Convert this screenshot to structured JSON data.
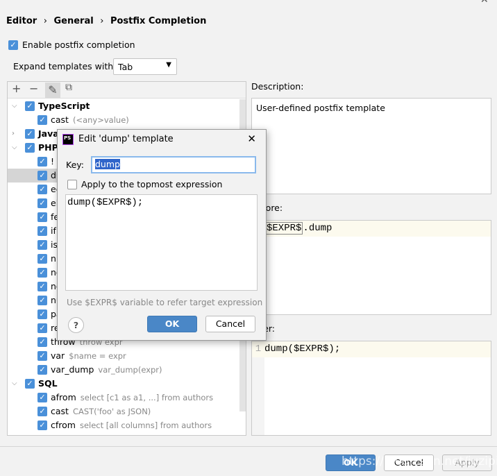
{
  "breadcrumb": [
    "Editor",
    "General",
    "Postfix Completion"
  ],
  "enable_label": "Enable postfix completion",
  "expand": {
    "label": "Expand templates with",
    "value": "Tab"
  },
  "toolbar": {
    "add": "+",
    "remove": "−",
    "edit": "✎",
    "copy": "⧉"
  },
  "tree": [
    {
      "type": "group",
      "label": "TypeScript",
      "expanded": true
    },
    {
      "type": "item",
      "label": "cast",
      "hint": "(<any>value)"
    },
    {
      "type": "group",
      "label": "Java",
      "expanded": false
    },
    {
      "type": "group",
      "label": "PHP",
      "expanded": true
    },
    {
      "type": "item",
      "label": "!",
      "hint": ""
    },
    {
      "type": "item",
      "label": "dump",
      "hint": "",
      "selected": true
    },
    {
      "type": "item",
      "label": "ec",
      "hint": ""
    },
    {
      "type": "item",
      "label": "el",
      "hint": ""
    },
    {
      "type": "item",
      "label": "fe",
      "hint": ""
    },
    {
      "type": "item",
      "label": "if",
      "hint": ""
    },
    {
      "type": "item",
      "label": "is",
      "hint": ""
    },
    {
      "type": "item",
      "label": "nn",
      "hint": ""
    },
    {
      "type": "item",
      "label": "no",
      "hint": ""
    },
    {
      "type": "item",
      "label": "no",
      "hint": ""
    },
    {
      "type": "item",
      "label": "nu",
      "hint": ""
    },
    {
      "type": "item",
      "label": "pa",
      "hint": ""
    },
    {
      "type": "item",
      "label": "re",
      "hint": ""
    },
    {
      "type": "item",
      "label": "throw",
      "hint": "throw expr"
    },
    {
      "type": "item",
      "label": "var",
      "hint": "$name = expr"
    },
    {
      "type": "item",
      "label": "var_dump",
      "hint": "var_dump(expr)"
    },
    {
      "type": "group",
      "label": "SQL",
      "expanded": true
    },
    {
      "type": "item",
      "label": "afrom",
      "hint": "select [c1 as a1, ...] from authors"
    },
    {
      "type": "item",
      "label": "cast",
      "hint": "CAST('foo' as JSON)"
    },
    {
      "type": "item",
      "label": "cfrom",
      "hint": "select [all columns] from authors"
    }
  ],
  "description": {
    "label": "Description:",
    "text": "User-defined postfix template"
  },
  "before": {
    "label": "Before:",
    "expr": "$EXPR$",
    "rest": ".dump"
  },
  "after": {
    "label": "After:",
    "line_no": "1",
    "code": "dump($EXPR$);"
  },
  "buttons": {
    "ok": "OK",
    "cancel": "Cancel",
    "apply": "Apply"
  },
  "watermark": "https://blog.csdn.net/juzipiao",
  "dialog": {
    "title": "Edit 'dump' template",
    "key_label": "Key:",
    "key_value": "dump",
    "topmost_label": "Apply to the topmost expression",
    "template": "dump($EXPR$);",
    "hint": "Use $EXPR$ variable to refer target expression",
    "ok": "OK",
    "cancel": "Cancel",
    "help": "?"
  },
  "colors": {
    "accent": "#4a87c7",
    "checkbox": "#4a90d9",
    "selection": "#d5d5d5"
  }
}
